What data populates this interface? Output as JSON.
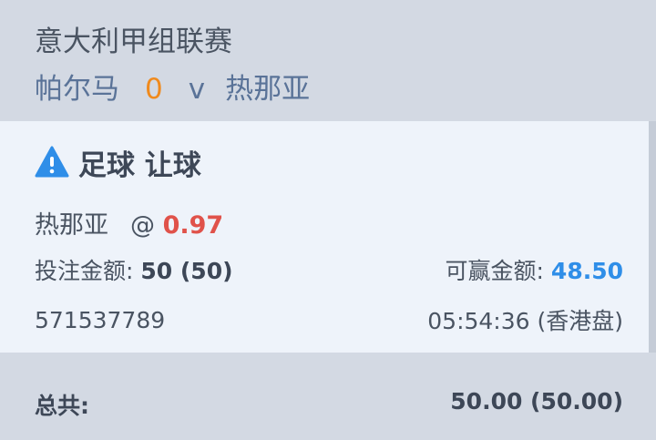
{
  "header": {
    "league": "意大利甲组联赛",
    "home_team": "帕尔马",
    "score": "0",
    "vs": "v",
    "away_team": "热那亚"
  },
  "bet": {
    "icon": "warning-icon",
    "type_label": "足球 让球",
    "selection": "热那亚",
    "odds_prefix": "@",
    "odds": "0.97",
    "stake_label": "投注金额:",
    "stake_value": "50 (50)",
    "payout_label": "可赢金额:",
    "payout_value": "48.50",
    "ticket_id": "571537789",
    "time": "05:54:36 (香港盘)"
  },
  "footer": {
    "total_label": "总共:",
    "total_value": "50.00 (50.00)"
  },
  "colors": {
    "background": "#d3d9e3",
    "card": "#eef3fa",
    "accent_blue": "#2f8ee8",
    "odds_red": "#e0524a",
    "score_orange": "#f08a1c"
  }
}
